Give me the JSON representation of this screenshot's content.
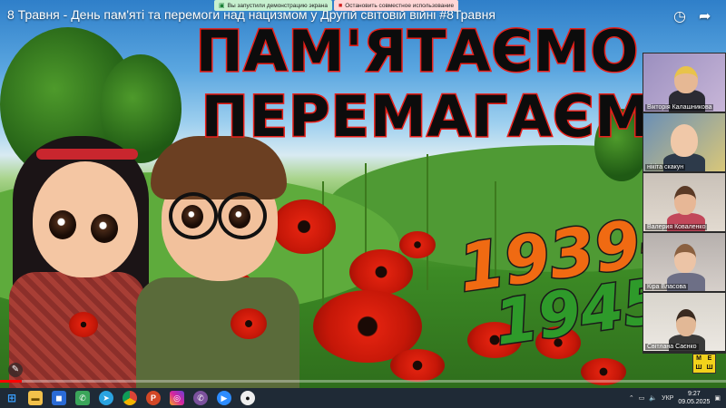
{
  "video": {
    "title": "8 Травня - День пам'яті та перемоги над нацизмом у Другій світовій війні #8Травня",
    "headline_line1": "ПАМ'ЯТАЄМО",
    "headline_line2": "ПЕРЕМАГАЄМ",
    "years_start": "1939–",
    "years_end": "1945",
    "progress_fraction": 0.03
  },
  "share_bar": {
    "status_label": "Вы запустили демонстрацию экрана",
    "stop_label": "Остановить совместное использование"
  },
  "player_icons": {
    "watch_later": "clock-icon",
    "share": "share-arrow-icon"
  },
  "participants": [
    {
      "name": "Вікторія Калашникова"
    },
    {
      "name": "нікіта скакун"
    },
    {
      "name": "Валерия Коваленко"
    },
    {
      "name": "Кіра Власова"
    },
    {
      "name": "Світлана Саєнко"
    }
  ],
  "app_badge": {
    "cells": [
      "М",
      "Е",
      "Ш",
      "Ш"
    ]
  },
  "taskbar": {
    "icons": [
      "windows-start-icon",
      "file-explorer-icon",
      "store-icon",
      "phone-link-icon",
      "telegram-icon",
      "chrome-icon",
      "powerpoint-icon",
      "instagram-icon",
      "viber-icon",
      "zoom-icon",
      "panda-icon"
    ],
    "language": "УКР",
    "time": "9:27",
    "date": "09.05.2025"
  },
  "colors": {
    "headline_stroke": "#e8201a",
    "years_orange": "#f06a12",
    "years_green": "#2e9a2a",
    "progress": "#ff0000",
    "taskbar": "#1f2a36"
  }
}
